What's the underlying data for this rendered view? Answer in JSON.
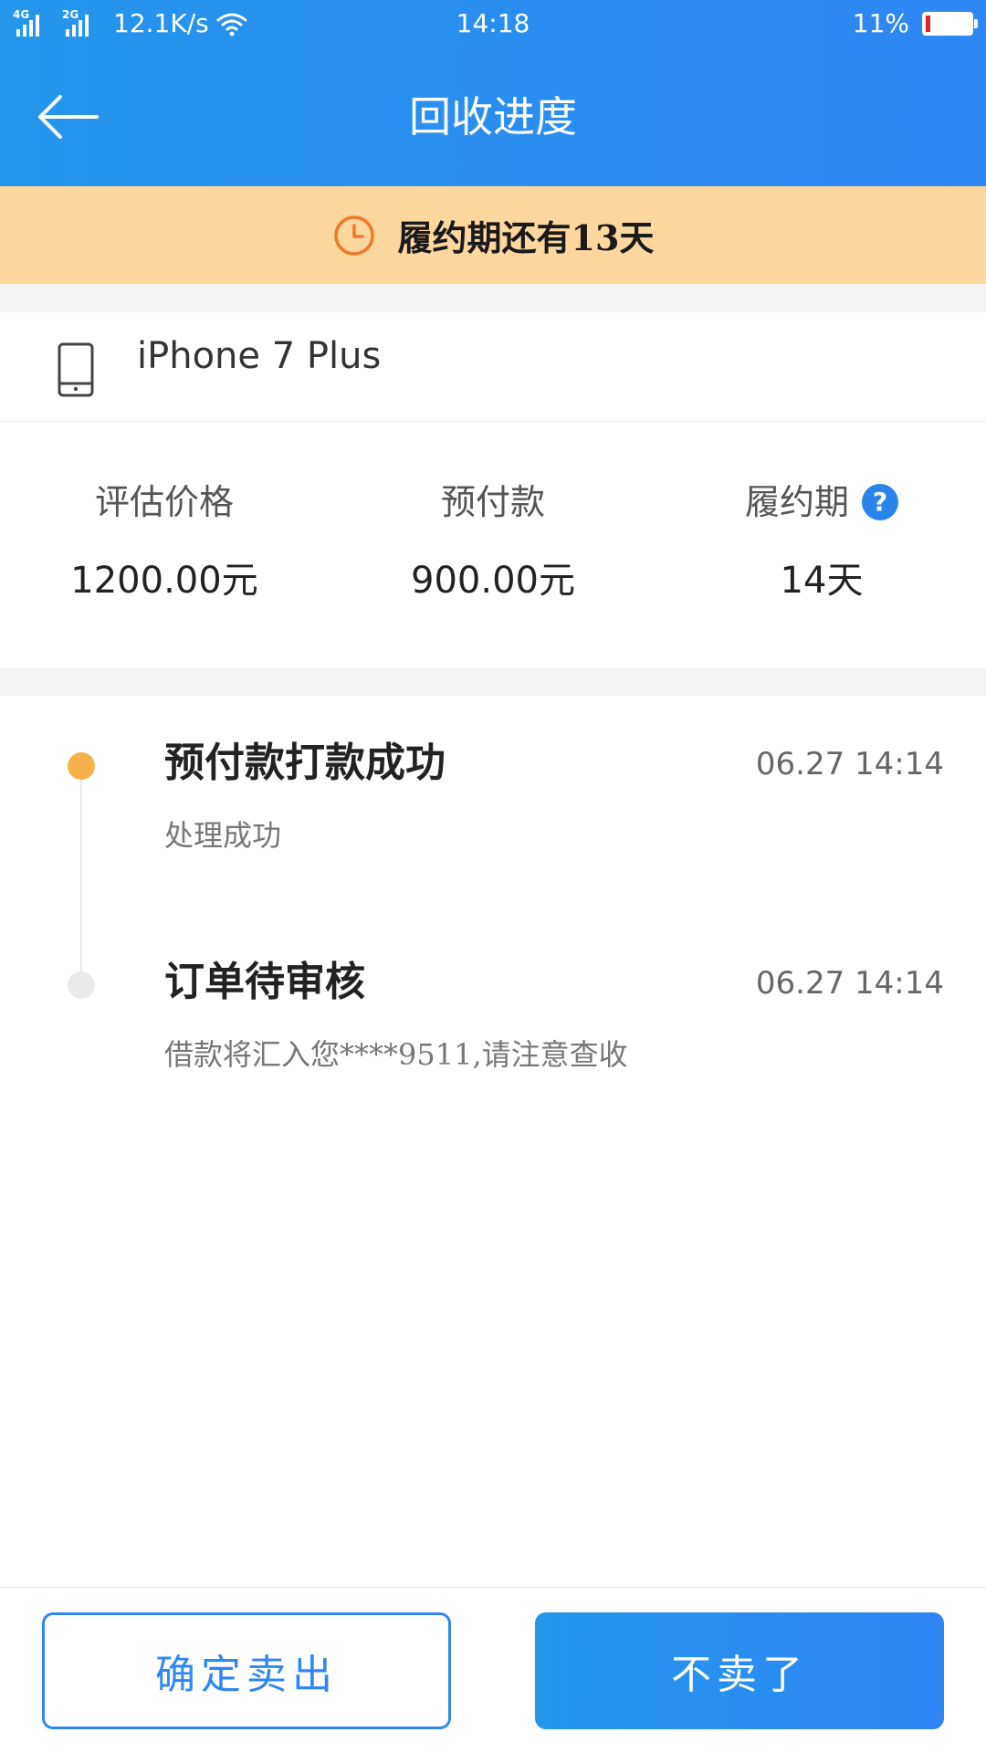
{
  "status_bar": {
    "network_1": "4G",
    "network_2": "2G",
    "speed": "12.1K/s",
    "time": "14:18",
    "battery_percent": "11%",
    "battery_level": 0.11
  },
  "nav": {
    "title": "回收进度",
    "back_icon": "arrow-left-icon"
  },
  "notice": {
    "icon": "clock-icon",
    "text": "履约期还有13天"
  },
  "device": {
    "icon": "phone-icon",
    "name": "iPhone 7 Plus"
  },
  "stats": {
    "estimated_price_label": "评估价格",
    "estimated_price_value": "1200.00元",
    "prepayment_label": "预付款",
    "prepayment_value": "900.00元",
    "term_label": "履约期",
    "term_value": "14天",
    "help_symbol": "?"
  },
  "timeline": {
    "items": [
      {
        "title": "预付款打款成功",
        "time": "06.27 14:14",
        "desc": "处理成功",
        "dot_color": "#f6b14a"
      },
      {
        "title": "订单待审核",
        "time": "06.27 14:14",
        "desc": "借款将汇入您****9511,请注意查收",
        "dot_color": "#eaeaea"
      }
    ]
  },
  "actions": {
    "confirm_label": "确定卖出",
    "cancel_label": "不卖了"
  },
  "colors": {
    "primary": "#2f86f5",
    "notice_bg": "#fdd79d",
    "notice_icon": "#f0782a",
    "battery_low": "#e8202a"
  }
}
